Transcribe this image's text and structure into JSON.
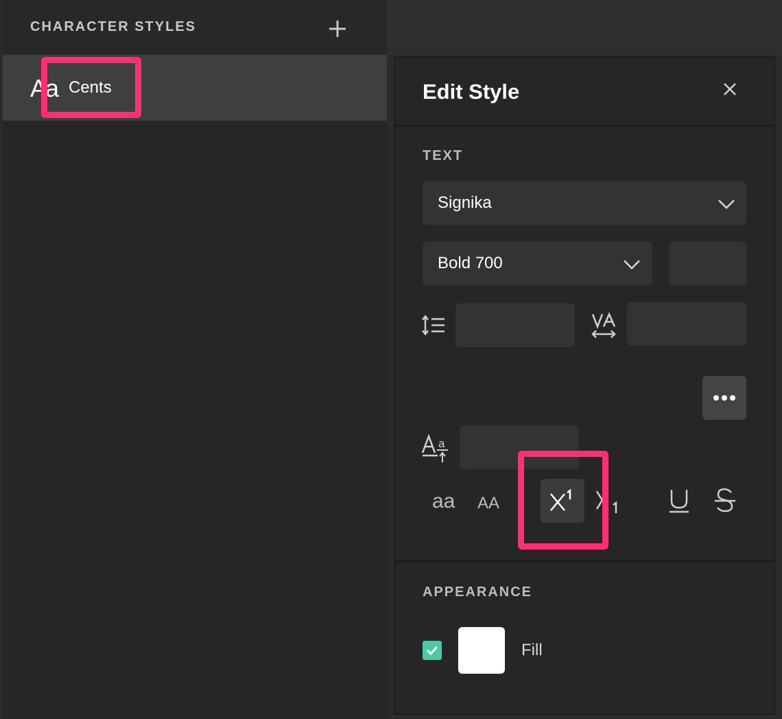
{
  "left": {
    "title": "CHARACTER STYLES",
    "add_icon": "plus-icon",
    "styles": [
      {
        "preview": "Aa",
        "name": "Cents"
      }
    ]
  },
  "editor": {
    "title": "Edit Style",
    "close_icon": "close-icon",
    "text_section": {
      "label": "TEXT",
      "font_family": "Signika",
      "font_weight": "Bold 700",
      "font_size": "",
      "line_height": "",
      "letter_spacing": "",
      "baseline_shift": "",
      "more_icon": "more-horizontal-icon",
      "case_buttons": [
        "aa",
        "AA"
      ],
      "position_buttons": [
        "superscript",
        "subscript"
      ],
      "selected_position": "superscript",
      "decoration_buttons": [
        "underline",
        "strikethrough"
      ]
    },
    "appearance_section": {
      "label": "APPEARANCE",
      "fill_enabled": true,
      "fill_color": "#ffffff",
      "fill_label": "Fill"
    }
  },
  "colors": {
    "highlight": "#ff2f72",
    "checkbox": "#4fc8a8",
    "panel_bg": "#262626",
    "field_bg": "#333333"
  }
}
